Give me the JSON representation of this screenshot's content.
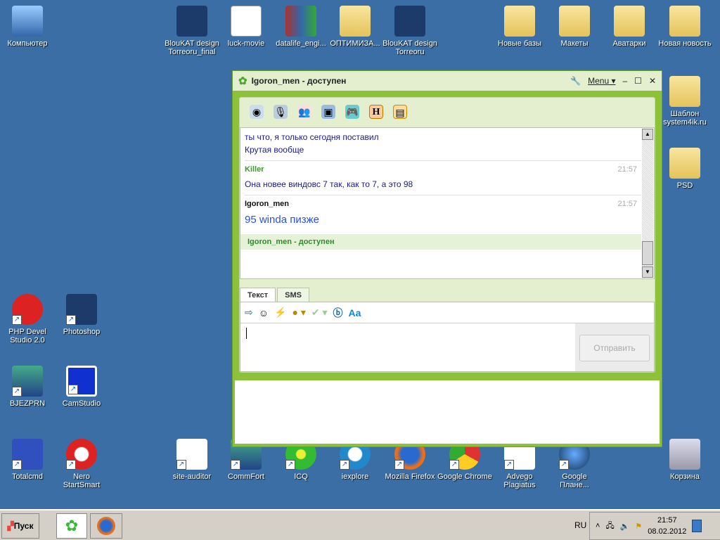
{
  "desktop_icons": [
    {
      "label": "Компьютер",
      "kind": "computer"
    },
    {
      "label": "BlouKAT design Torreoru_final",
      "kind": "psd"
    },
    {
      "label": "luck-movie",
      "kind": "doc"
    },
    {
      "label": "datalife_engi...",
      "kind": "rar"
    },
    {
      "label": "ОПТИМИЗА...",
      "kind": "folder"
    },
    {
      "label": "BlouKAT design Torreoru",
      "kind": "psd"
    },
    {
      "label": "Новые базы",
      "kind": "folder"
    },
    {
      "label": "Макеты",
      "kind": "folder"
    },
    {
      "label": "Аватарки",
      "kind": "folder"
    },
    {
      "label": "Новая новость",
      "kind": "folder"
    },
    {
      "label": "Шаблон system4ik.ru",
      "kind": "folder"
    },
    {
      "label": "PSD",
      "kind": "folder"
    },
    {
      "label": "PHP Devel Studio 2.0",
      "kind": "soul"
    },
    {
      "label": "Photoshop",
      "kind": "ps"
    },
    {
      "label": "BJEZPRN",
      "kind": "app"
    },
    {
      "label": "CamStudio",
      "kind": "cam"
    },
    {
      "label": "Totalcmd",
      "kind": "disk"
    },
    {
      "label": "Nero StartSmart",
      "kind": "nero"
    },
    {
      "label": "site-auditor",
      "kind": "cursor"
    },
    {
      "label": "CommFort",
      "kind": "app"
    },
    {
      "label": "ICQ",
      "kind": "icq"
    },
    {
      "label": "iexplore",
      "kind": "ie"
    },
    {
      "label": "Mozilla Firefox",
      "kind": "ff"
    },
    {
      "label": "Google Chrome",
      "kind": "chrome"
    },
    {
      "label": "Advego Plagiatus",
      "kind": "advego"
    },
    {
      "label": "Google Плане...",
      "kind": "earth"
    },
    {
      "label": "Корзина",
      "kind": "trash"
    }
  ],
  "window": {
    "title": "Igoron_men - доступен",
    "menu_label": "Menu",
    "messages": [
      {
        "sender": "",
        "time": "",
        "lines": [
          "ты что, я только сегодня поставил",
          "Крутая вообще"
        ]
      },
      {
        "sender": "Killer",
        "time": "21:57",
        "lines": [
          "Она новее виндовс 7 так, как то 7, а это 98"
        ]
      },
      {
        "sender": "Igoron_men",
        "time": "21:57",
        "lines": [
          "95 winda пизже"
        ]
      }
    ],
    "status_line": "Igoron_men - доступен",
    "tabs": [
      "Текст",
      "SMS"
    ],
    "input_value": "",
    "send_label": "Отправить"
  },
  "taskbar": {
    "start_label": "Пуск",
    "lang": "RU",
    "time": "21:57",
    "date": "08.02.2012"
  }
}
